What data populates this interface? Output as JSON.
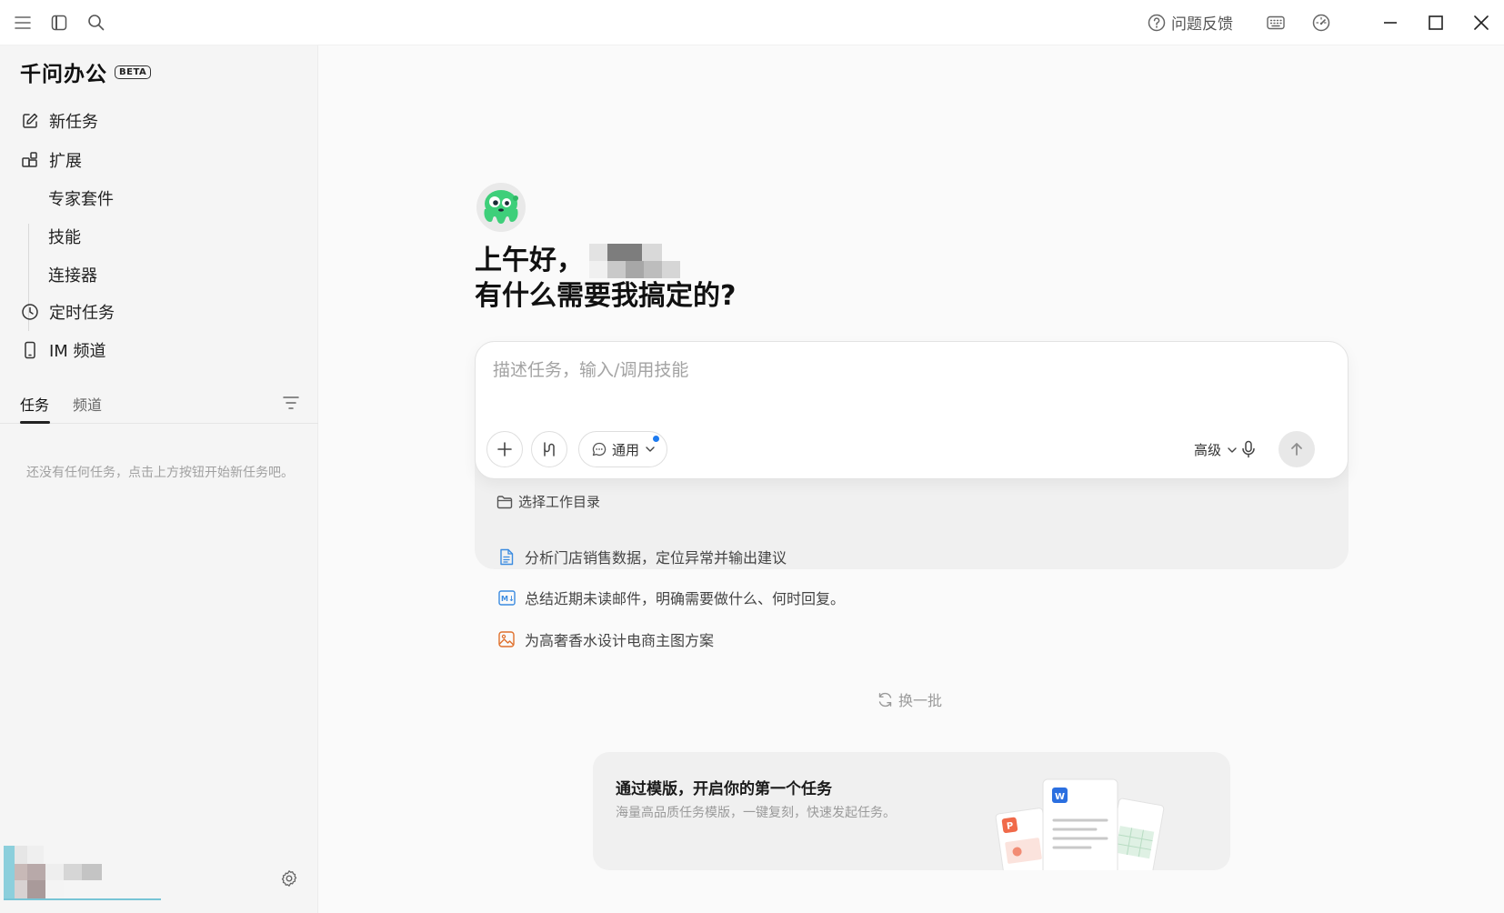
{
  "titlebar": {
    "feedback_label": "问题反馈",
    "icons": [
      "menu-icon",
      "sidebar-toggle-icon",
      "search-icon",
      "help-circle-icon",
      "keyboard-icon",
      "speed-gauge-icon",
      "minimize-icon",
      "maximize-icon",
      "close-icon"
    ]
  },
  "sidebar": {
    "brand": "千问办公",
    "beta": "BETA",
    "nav": {
      "new_task": "新任务",
      "extensions": "扩展",
      "expert_suite": "专家套件",
      "skills": "技能",
      "connectors": "连接器",
      "scheduled_tasks": "定时任务",
      "im_channels": "IM 频道"
    },
    "tabs": {
      "tasks": "任务",
      "channels": "频道",
      "active": "任务"
    },
    "empty_hint": "还没有任何任务，点击上方按钮开始新任务吧。"
  },
  "main": {
    "greeting": "上午好，",
    "greeting_question": "有什么需要我搞定的?",
    "composer": {
      "placeholder": "描述任务，输入/调用技能",
      "mode_label": "通用",
      "advanced_label": "高级",
      "workdir_label": "选择工作目录"
    },
    "suggestions": [
      {
        "text": "分析门店销售数据，定位异常并输出建议",
        "icon": "document-icon"
      },
      {
        "text": "总结近期未读邮件，明确需要做什么、何时回复。",
        "icon": "markdown-icon"
      },
      {
        "text": "为高奢香水设计电商主图方案",
        "icon": "image-icon"
      }
    ],
    "refresh_label": "换一批",
    "template_card": {
      "title": "通过模版，开启你的第一个任务",
      "subtitle": "海量高品质任务模版，一键复刻，快速发起任务。",
      "badges": {
        "ppt": "P",
        "word": "W"
      }
    }
  },
  "colors": {
    "accent_blue": "#1e7bf0",
    "mascot_green": "#3ecf7a",
    "ppt_orange": "#f06a4a",
    "word_blue": "#2b6fe0"
  }
}
